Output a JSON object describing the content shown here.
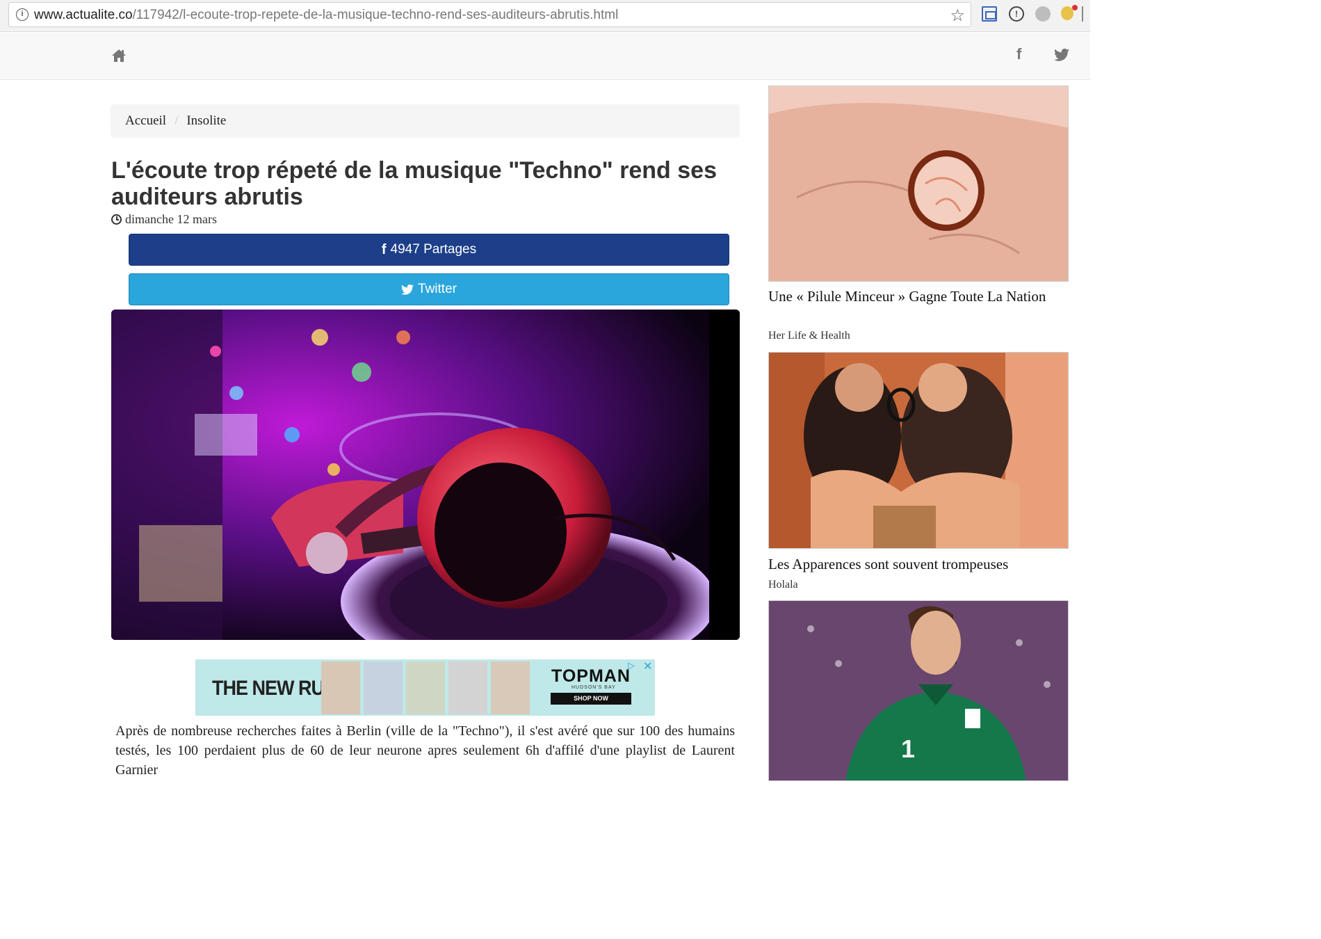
{
  "browser": {
    "url_domain": "www.actualite.co",
    "url_path": "/117942/l-ecoute-trop-repete-de-la-musique-techno-rend-ses-auditeurs-abrutis.html",
    "info_icon": "i"
  },
  "nav": {
    "home_icon": "home-icon",
    "facebook_icon": "f",
    "twitter_icon": "twitter-icon"
  },
  "breadcrumb": {
    "items": [
      "Accueil",
      "Insolite"
    ],
    "separator": "/"
  },
  "article": {
    "title": "L'écoute trop répeté de la musique \"Techno\" rend ses auditeurs abrutis",
    "date": "dimanche 12 mars",
    "share_facebook": "4947 Partages",
    "share_twitter": "Twitter",
    "fb_glyph": "f",
    "body": "Après de nombreuse recherches faites à Berlin (ville de la \"Techno\"), il s'est avéré que sur 100 des humains testés, les 100 perdaient plus de 60 de leur neurone apres seulement 6h d'affilé d'une playlist de Laurent Garnier"
  },
  "ad": {
    "headline": "THE NEW RULES",
    "brand": "TOPMAN",
    "sub_brand": "HUDSON'S BAY",
    "cta": "SHOP NOW",
    "adchoices": "▷",
    "close": "✕"
  },
  "sidebar": {
    "items": [
      {
        "title": "Une « Pilule Minceur » Gagne Toute La Nation",
        "source": "Her Life & Health"
      },
      {
        "title": "Les Apparences sont souvent trompeuses",
        "source": "Holala"
      }
    ]
  },
  "colors": {
    "facebook": "#1d3f8a",
    "twitter": "#2aa6dd",
    "ad_bg": "#bfe8e8"
  }
}
